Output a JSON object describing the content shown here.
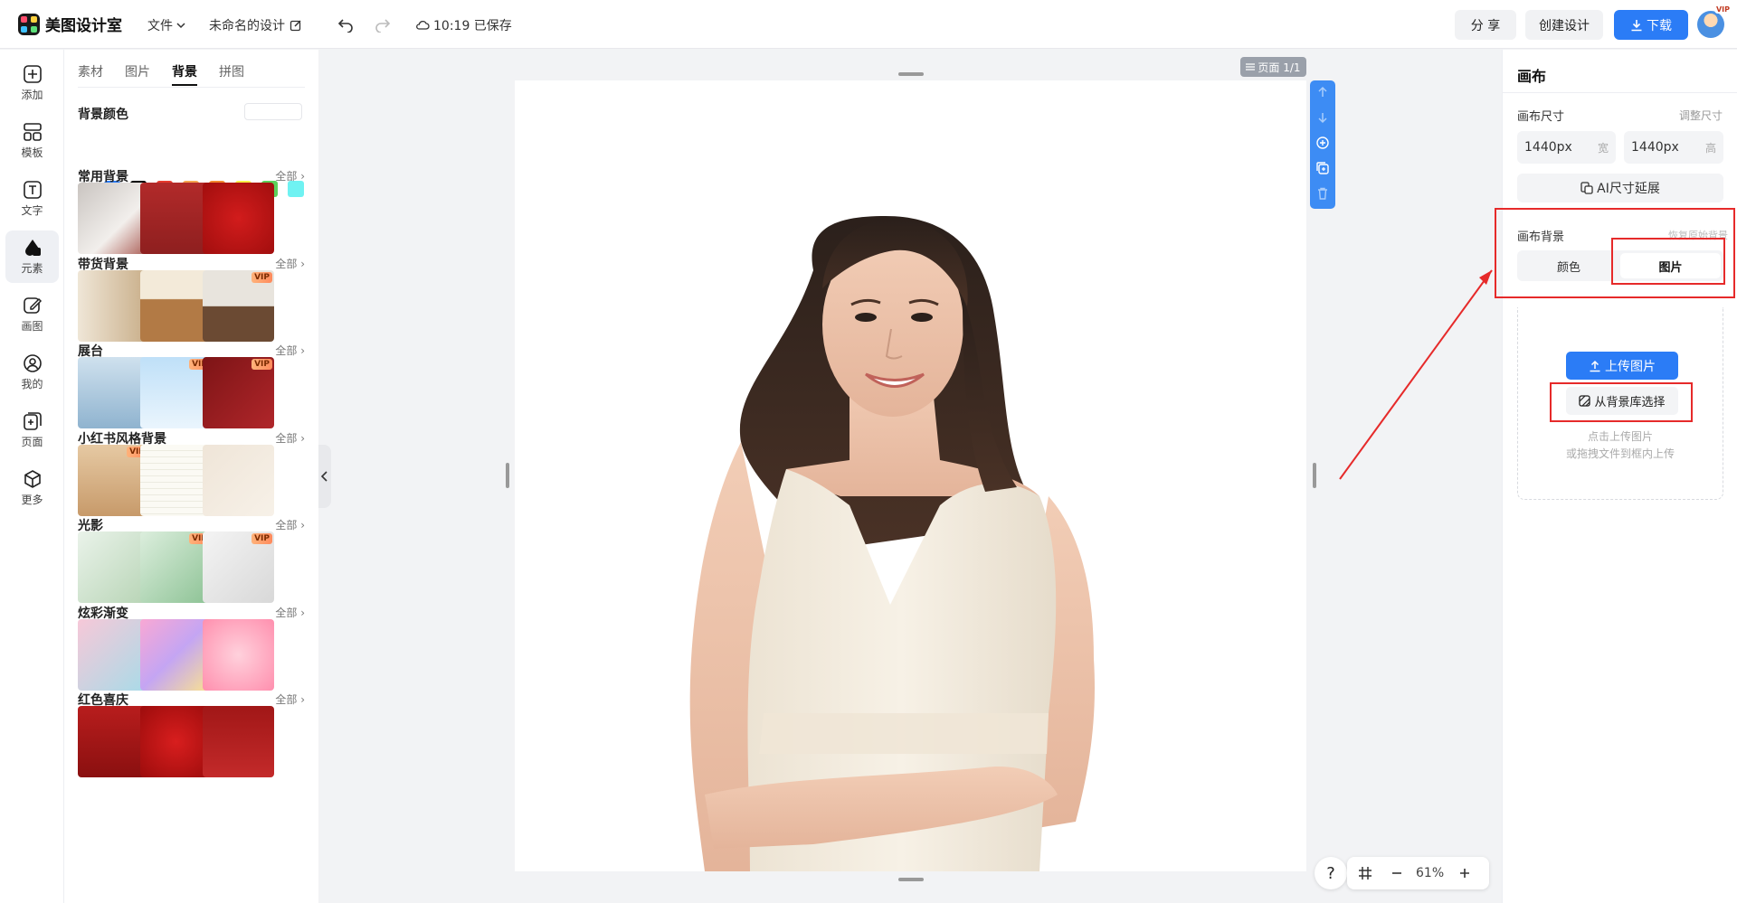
{
  "app": {
    "name": "美图设计室"
  },
  "topbar": {
    "file_menu": "文件",
    "doc_title": "未命名的设计",
    "save_status": "10:19 已保存",
    "share_label": "分 享",
    "create_label": "创建设计",
    "download_label": "下载",
    "avatar_badge": "VIP"
  },
  "rail": {
    "items": [
      {
        "label": "添加",
        "icon": "plus-square-icon"
      },
      {
        "label": "模板",
        "icon": "template-icon"
      },
      {
        "label": "文字",
        "icon": "text-icon"
      },
      {
        "label": "元素",
        "icon": "shapes-icon"
      },
      {
        "label": "画图",
        "icon": "pencil-icon"
      },
      {
        "label": "我的",
        "icon": "user-icon"
      },
      {
        "label": "页面",
        "icon": "page-add-icon"
      },
      {
        "label": "更多",
        "icon": "cube-icon"
      }
    ]
  },
  "panel": {
    "tabs": [
      "素材",
      "图片",
      "背景",
      "拼图"
    ],
    "bg_color_title": "背景颜色",
    "colors": [
      "#e9e9e9",
      "#ffffff",
      "#000000",
      "#e63b2e",
      "#f5a650",
      "#f28a30",
      "#f8f04a",
      "#5cd15c",
      "#6ff2f2",
      "#2e7cf0",
      "#8a4cf0"
    ],
    "see_all": "全部",
    "vip": "VIP",
    "sections": [
      {
        "title": "常用背景"
      },
      {
        "title": "带货背景"
      },
      {
        "title": "展台"
      },
      {
        "title": "小红书风格背景"
      },
      {
        "title": "光影"
      },
      {
        "title": "炫彩渐变"
      },
      {
        "title": "红色喜庆"
      }
    ]
  },
  "canvas": {
    "page_badge": "页面 1/1",
    "zoom": "61%",
    "help": "?"
  },
  "right": {
    "title": "画布",
    "size_label": "画布尺寸",
    "resize_link": "调整尺寸",
    "width_value": "1440px",
    "width_unit": "宽",
    "height_value": "1440px",
    "height_unit": "高",
    "ai_expand": "AI尺寸延展",
    "bg_label": "画布背景",
    "restore_bg": "恢复原始背景",
    "seg_color": "颜色",
    "seg_image": "图片",
    "upload_btn": "上传图片",
    "library_btn": "从背景库选择",
    "hint_line1": "点击上传图片",
    "hint_line2": "或拖拽文件到框内上传"
  }
}
